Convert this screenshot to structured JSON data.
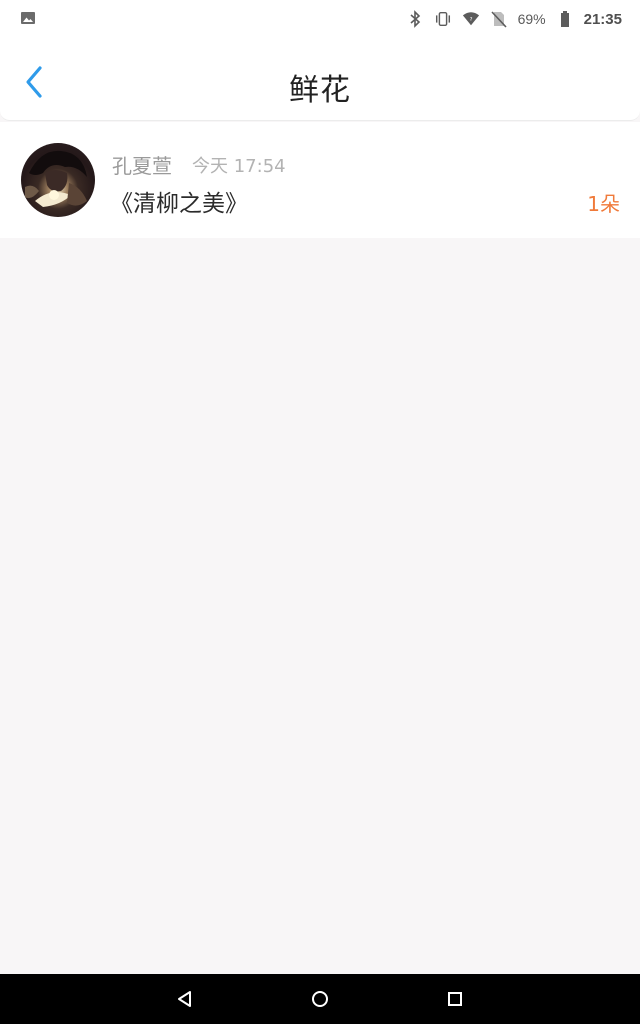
{
  "status_bar": {
    "battery_percent": "69%",
    "time": "21:35",
    "left_icon": "image-icon",
    "right_icons": [
      "bluetooth-icon",
      "vibrate-icon",
      "wifi-icon",
      "no-sim-icon",
      "battery-icon"
    ]
  },
  "header": {
    "back_icon": "chevron-left-icon",
    "title": "鲜花"
  },
  "flowers": [
    {
      "user_name": "孔夏萱",
      "time": "今天 17:54",
      "title": "《清柳之美》",
      "count": "1朵"
    }
  ],
  "nav_buttons": [
    "back-triangle-icon",
    "home-circle-icon",
    "recents-square-icon"
  ],
  "colors": {
    "accent_blue": "#2f9bea",
    "count_orange": "#f07a3a",
    "background": "#f8f6f7"
  }
}
